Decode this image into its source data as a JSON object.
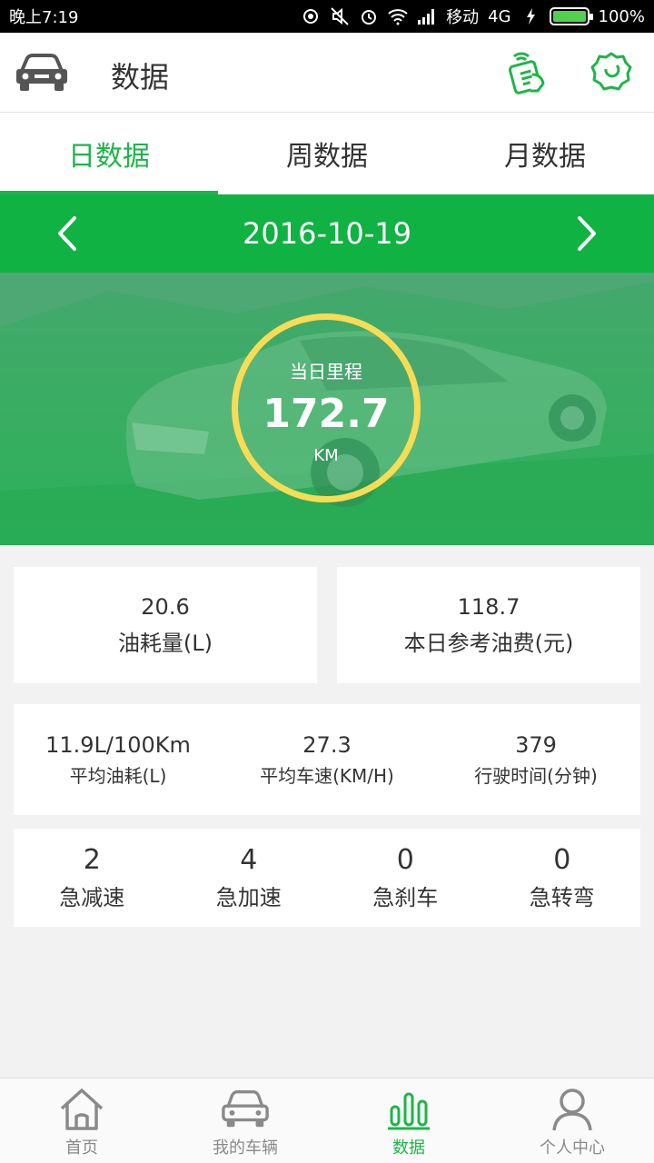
{
  "status_bar": {
    "time": "晚上7:19",
    "carrier": "移动",
    "network": "4G",
    "battery": "100%",
    "battery_level": 1.0,
    "icons": [
      "sync-icon",
      "mute-icon",
      "alarm-icon",
      "wifi-icon",
      "signal-icon",
      "charging-icon",
      "battery-icon"
    ]
  },
  "header": {
    "title": "数据",
    "left_icon": "car-icon",
    "right_icons": [
      "device-connect-icon",
      "settings-icon"
    ],
    "accent_color": "#1db548"
  },
  "tabs": [
    {
      "label": "日数据",
      "active": true
    },
    {
      "label": "周数据",
      "active": false
    },
    {
      "label": "月数据",
      "active": false
    }
  ],
  "date_bar": {
    "date": "2016-10-19",
    "prev_icon": "chevron-left-icon",
    "next_icon": "chevron-right-icon",
    "bg_color": "#10b243"
  },
  "mileage": {
    "label": "当日里程",
    "value": "172.7",
    "unit": "KM",
    "ring_color": "#f8dc55"
  },
  "fuel_cards": [
    {
      "value": "20.6",
      "label": "油耗量(L)"
    },
    {
      "value": "118.7",
      "label": "本日参考油费(元)"
    }
  ],
  "driving_stats": [
    {
      "value": "11.9L/100Km",
      "label": "平均油耗(L)"
    },
    {
      "value": "27.3",
      "label": "平均车速(KM/H)"
    },
    {
      "value": "379",
      "label": "行驶时间(分钟)"
    }
  ],
  "events": [
    {
      "value": "2",
      "label": "急减速"
    },
    {
      "value": "4",
      "label": "急加速"
    },
    {
      "value": "0",
      "label": "急刹车"
    },
    {
      "value": "0",
      "label": "急转弯"
    }
  ],
  "bottom_nav": [
    {
      "label": "首页",
      "icon": "home-icon",
      "active": false
    },
    {
      "label": "我的车辆",
      "icon": "car-icon",
      "active": false
    },
    {
      "label": "数据",
      "icon": "bar-chart-icon",
      "active": true
    },
    {
      "label": "个人中心",
      "icon": "person-icon",
      "active": false
    }
  ]
}
